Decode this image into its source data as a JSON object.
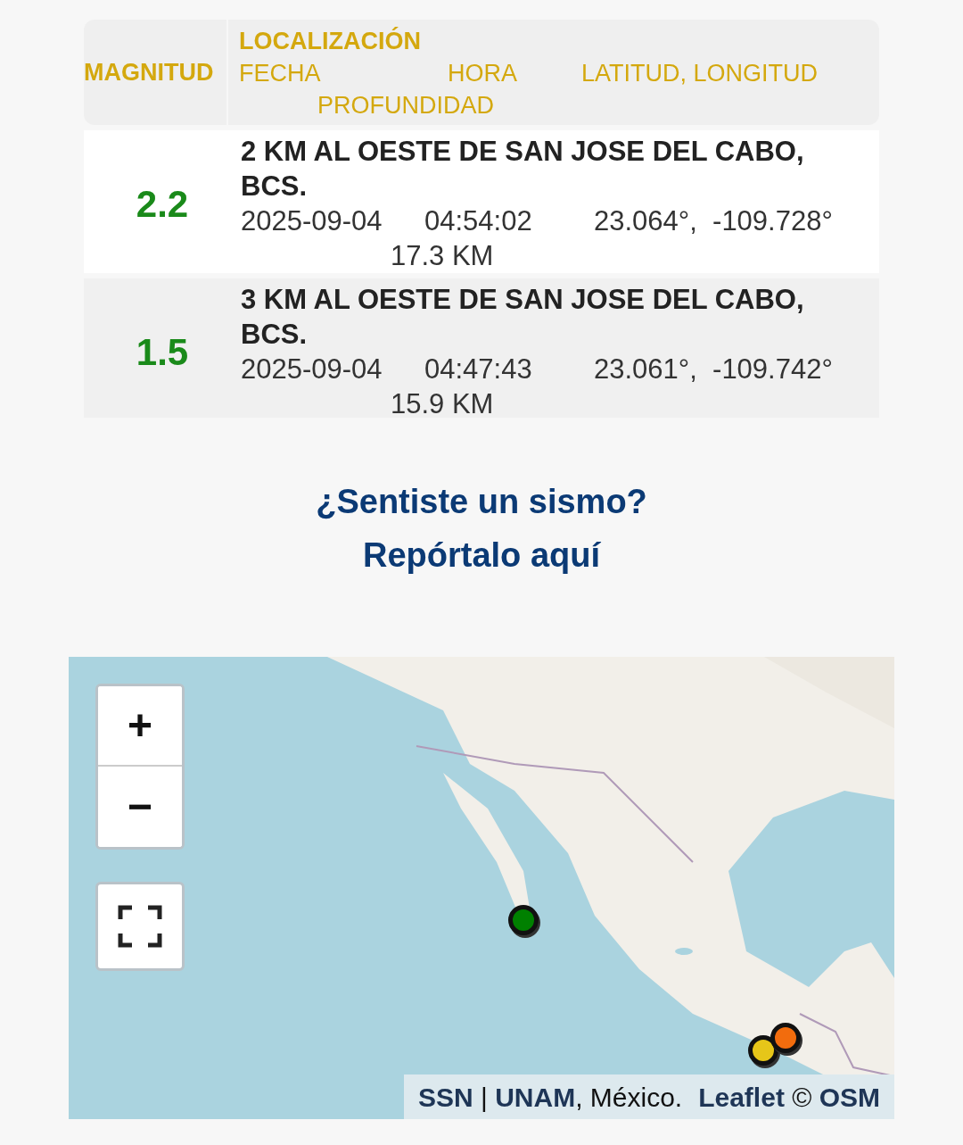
{
  "table": {
    "header": {
      "magnitude": "MAGNITUD",
      "location": "LOCALIZACIÓN",
      "date": "FECHA",
      "time": "HORA",
      "coords": "LATITUD, LONGITUD",
      "depth": "PROFUNDIDAD"
    },
    "rows": [
      {
        "magnitude": "2.2",
        "place": "2 KM AL OESTE DE SAN JOSE DEL CABO, BCS.",
        "date": "2025-09-04",
        "time": "04:54:02",
        "coords": "23.064°,  -109.728°",
        "depth": "17.3 KM"
      },
      {
        "magnitude": "1.5",
        "place": "3 KM AL OESTE DE SAN JOSE DEL CABO, BCS.",
        "date": "2025-09-04",
        "time": "04:47:43",
        "coords": "23.061°,  -109.742°",
        "depth": "15.9 KM"
      }
    ]
  },
  "report": {
    "lines": [
      "¿Sentiste un sismo?",
      "Repórtalo aquí"
    ]
  },
  "map": {
    "zoom_in": "+",
    "zoom_out": "−",
    "markers": [
      {
        "color": "#008000"
      },
      {
        "color": "#e6c619"
      },
      {
        "color": "#f26c0d"
      }
    ],
    "attribution": [
      "**SSN** | **UNAM**, México.",
      "**Leaflet** © **OSM**"
    ]
  }
}
